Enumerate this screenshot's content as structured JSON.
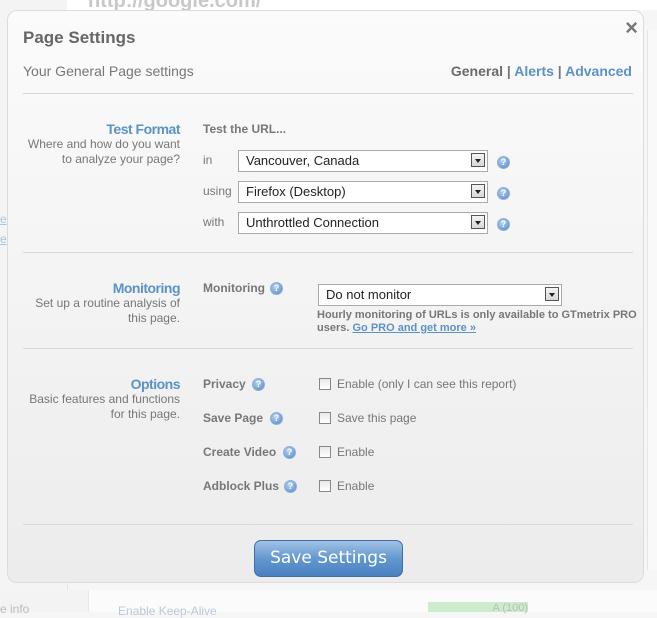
{
  "background": {
    "url_text": "http://google.com/",
    "bottom_info": "e info",
    "bottom_row": "Enable Keep-Alive",
    "bottom_grade": "A (100)"
  },
  "modal": {
    "title": "Page Settings",
    "subtitle": "Your General Page settings",
    "close_icon": "×",
    "tabs": [
      {
        "label": "General",
        "active": true
      },
      {
        "label": "Alerts",
        "active": false
      },
      {
        "label": "Advanced",
        "active": false
      }
    ],
    "tab_separator": "|",
    "test_format": {
      "title": "Test Format",
      "desc": "Where and how do you want to analyze your page?",
      "heading": "Test the URL...",
      "fields": [
        {
          "label": "in",
          "value": "Vancouver, Canada"
        },
        {
          "label": "using",
          "value": "Firefox (Desktop)"
        },
        {
          "label": "with",
          "value": "Unthrottled Connection"
        }
      ]
    },
    "monitoring": {
      "title": "Monitoring",
      "desc": "Set up a routine analysis of this page.",
      "label": "Monitoring",
      "value": "Do not monitor",
      "note": "Hourly monitoring of URLs is only available to GTmetrix PRO users.",
      "note_link": "Go PRO and get more »"
    },
    "options": {
      "title": "Options",
      "desc": "Basic features and functions for this page.",
      "items": [
        {
          "label": "Privacy",
          "checkbox_label": "Enable (only I can see this report)",
          "checked": false
        },
        {
          "label": "Save Page",
          "checkbox_label": "Save this page",
          "checked": false
        },
        {
          "label": "Create Video",
          "checkbox_label": "Enable",
          "checked": false
        },
        {
          "label": "Adblock Plus",
          "checkbox_label": "Enable",
          "checked": false
        }
      ]
    },
    "save_button": "Save Settings",
    "help_glyph": "?"
  }
}
